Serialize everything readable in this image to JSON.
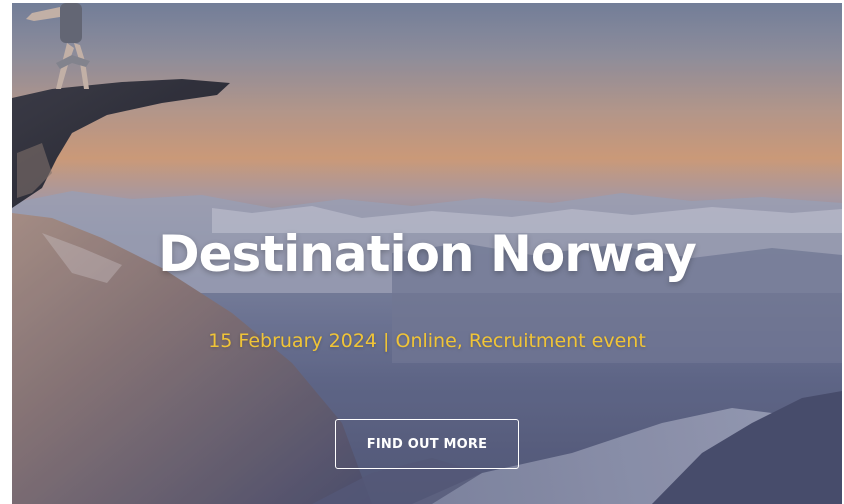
{
  "hero": {
    "title": "Destination Norway",
    "subtitle": "15 February 2024 | Online, Recruitment event",
    "cta_label": "FIND OUT MORE"
  },
  "colors": {
    "title": "#ffffff",
    "subtitle": "#f0c437",
    "button_border": "#ffffff"
  }
}
